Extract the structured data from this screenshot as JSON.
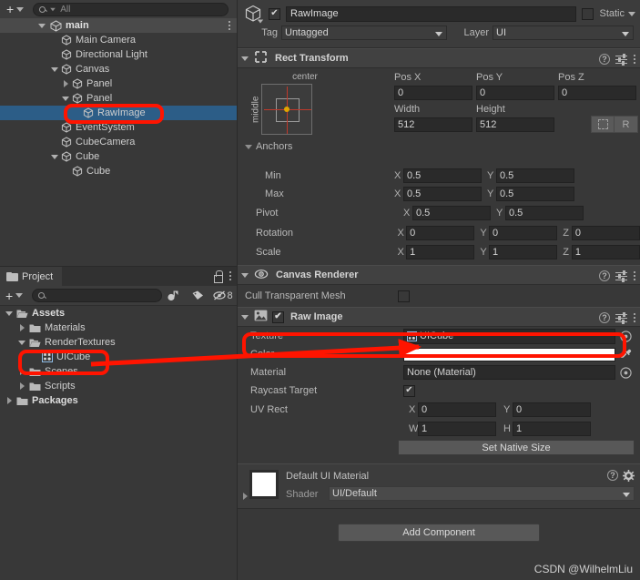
{
  "hierarchy": {
    "toolbar": {
      "add_label": "+",
      "search_placeholder": "All",
      "search_value": "",
      "search_icon": "search-icon"
    },
    "root": {
      "label": "main",
      "icon": "unity-scene-icon",
      "menu_icon": "kebab-menu-icon"
    },
    "items": [
      {
        "label": "Main Camera",
        "indent": 2,
        "fold": "none",
        "icon": "gameobject-cube-icon",
        "selected": false
      },
      {
        "label": "Directional Light",
        "indent": 2,
        "fold": "none",
        "icon": "gameobject-cube-icon",
        "selected": false
      },
      {
        "label": "Canvas",
        "indent": 2,
        "fold": "open",
        "icon": "gameobject-cube-icon",
        "selected": false
      },
      {
        "label": "Panel",
        "indent": 3,
        "fold": "closed",
        "icon": "gameobject-cube-icon",
        "selected": false
      },
      {
        "label": "Panel",
        "indent": 3,
        "fold": "open",
        "icon": "gameobject-cube-icon",
        "selected": false
      },
      {
        "label": "RawImage",
        "indent": 4,
        "fold": "none",
        "icon": "gameobject-cube-icon",
        "selected": true
      },
      {
        "label": "EventSystem",
        "indent": 2,
        "fold": "none",
        "icon": "gameobject-cube-icon",
        "selected": false
      },
      {
        "label": "CubeCamera",
        "indent": 2,
        "fold": "none",
        "icon": "gameobject-cube-icon",
        "selected": false
      },
      {
        "label": "Cube",
        "indent": 2,
        "fold": "open",
        "icon": "gameobject-cube-icon",
        "selected": false
      },
      {
        "label": "Cube",
        "indent": 3,
        "fold": "none",
        "icon": "gameobject-cube-icon",
        "selected": false
      }
    ]
  },
  "project": {
    "tab_label": "Project",
    "tab_icon": "folder-icon",
    "lock_icon": "lock-open-icon",
    "menu_icon": "kebab-menu-icon",
    "toolbar": {
      "add_label": "+",
      "search_placeholder": "",
      "search_value": "",
      "search_icon": "search-icon",
      "filter_type_icon": "filter-by-type-icon",
      "filter_label_icon": "filter-by-label-icon",
      "hidden_packages_icon": "packages-visibility-icon",
      "hidden_packages_count": "8"
    },
    "items": [
      {
        "label": "Assets",
        "indent": 0,
        "fold": "open",
        "icon": "folder-open-icon",
        "bold": true,
        "selected": false
      },
      {
        "label": "Materials",
        "indent": 1,
        "fold": "closed",
        "icon": "folder-icon",
        "bold": false,
        "selected": false
      },
      {
        "label": "RenderTextures",
        "indent": 1,
        "fold": "open",
        "icon": "folder-open-icon",
        "bold": false,
        "selected": false
      },
      {
        "label": "UICube",
        "indent": 2,
        "fold": "none",
        "icon": "render-texture-icon",
        "bold": false,
        "selected": false
      },
      {
        "label": "Scenes",
        "indent": 1,
        "fold": "closed",
        "icon": "folder-icon",
        "bold": false,
        "selected": false
      },
      {
        "label": "Scripts",
        "indent": 1,
        "fold": "closed",
        "icon": "folder-icon",
        "bold": false,
        "selected": false
      },
      {
        "label": "Packages",
        "indent": 0,
        "fold": "closed",
        "icon": "folder-icon",
        "bold": true,
        "selected": false
      }
    ]
  },
  "inspector": {
    "object_icon": "gameobject-cube-icon",
    "enabled": true,
    "name": "RawImage",
    "static_label": "Static",
    "static_checked": false,
    "tag_label": "Tag",
    "tag_value": "Untagged",
    "layer_label": "Layer",
    "layer_value": "UI",
    "rect_transform": {
      "title": "Rect Transform",
      "icon": "rect-transform-icon",
      "anchor_preset_top": "center",
      "anchor_preset_side": "middle",
      "pos_x_label": "Pos X",
      "pos_x": "0",
      "pos_y_label": "Pos Y",
      "pos_y": "0",
      "pos_z_label": "Pos Z",
      "pos_z": "0",
      "width_label": "Width",
      "width": "512",
      "height_label": "Height",
      "height": "512",
      "blueprint_icon": "blueprint-mode-icon",
      "rawedit_label": "R",
      "anchors_label": "Anchors",
      "min_label": "Min",
      "min_x": "0.5",
      "min_y": "0.5",
      "max_label": "Max",
      "max_x": "0.5",
      "max_y": "0.5",
      "pivot_label": "Pivot",
      "pivot_x": "0.5",
      "pivot_y": "0.5",
      "rotation_label": "Rotation",
      "rot_x": "0",
      "rot_y": "0",
      "rot_z": "0",
      "scale_label": "Scale",
      "scale_x": "1",
      "scale_y": "1",
      "scale_z": "1"
    },
    "canvas_renderer": {
      "title": "Canvas Renderer",
      "icon": "eye-icon",
      "cull_label": "Cull Transparent Mesh",
      "cull_checked": false
    },
    "raw_image": {
      "title": "Raw Image",
      "icon": "raw-image-icon",
      "enabled": true,
      "texture_label": "Texture",
      "texture_value": "UICube",
      "texture_icon": "render-texture-icon",
      "picker_icon": "object-picker-icon",
      "color_label": "Color",
      "color_value": "#FFFFFF",
      "eyedropper_icon": "eyedropper-icon",
      "material_label": "Material",
      "material_value": "None (Material)",
      "raycast_label": "Raycast Target",
      "raycast_checked": true,
      "uv_rect_label": "UV Rect",
      "uv_x": "0",
      "uv_y": "0",
      "uv_w": "1",
      "uv_h": "1",
      "set_native_size_label": "Set Native Size"
    },
    "material_preview": {
      "title": "Default UI Material",
      "shader_label": "Shader",
      "shader_value": "UI/Default",
      "swatch_color": "#FFFFFF",
      "help_icon": "help-icon",
      "gear_icon": "gear-icon"
    },
    "add_component_label": "Add Component"
  },
  "annotations": {
    "highlight_color": "#FF1400",
    "boxes": [
      "rawimage-hierarchy-row",
      "uicube-project-asset",
      "texture-property-row"
    ],
    "arrow": "uicube-to-texture-arrow"
  },
  "watermark": "CSDN @WilhelmLiu"
}
